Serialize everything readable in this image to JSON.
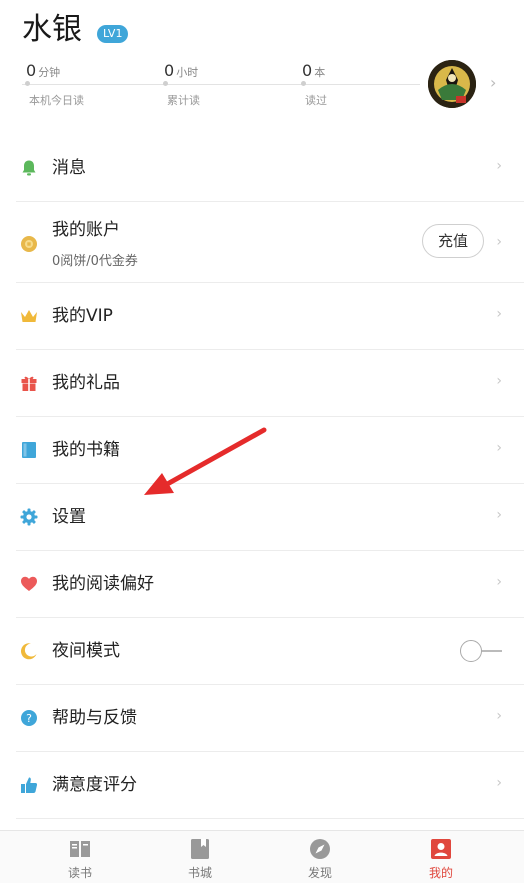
{
  "profile": {
    "username": "水银",
    "level": "LV1"
  },
  "stats": [
    {
      "value": "0",
      "unit": "分钟",
      "caption": "本机今日读"
    },
    {
      "value": "0",
      "unit": "小时",
      "caption": "累计读"
    },
    {
      "value": "0",
      "unit": "本",
      "caption": "读过"
    }
  ],
  "menu": {
    "messages": "消息",
    "account": "我的账户",
    "account_sub": "0阅饼/0代金券",
    "recharge": "充值",
    "vip": "我的VIP",
    "gifts": "我的礼品",
    "books": "我的书籍",
    "settings": "设置",
    "preferences": "我的阅读偏好",
    "night_mode": "夜间模式",
    "help": "帮助与反馈",
    "rating": "满意度评分"
  },
  "night_mode_on": false,
  "tabs": [
    {
      "label": "读书"
    },
    {
      "label": "书城"
    },
    {
      "label": "发现"
    },
    {
      "label": "我的"
    }
  ],
  "active_tab": "我的",
  "colors": {
    "accent_red": "#e0473d",
    "level_badge": "#3fa6d9",
    "annotation_arrow": "#e52b2b"
  }
}
